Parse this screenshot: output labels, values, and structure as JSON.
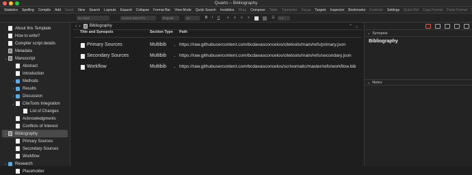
{
  "window": {
    "title": "Quarto – Bibliography"
  },
  "toolbar": {
    "items": [
      {
        "label": "Statistics",
        "enabled": true
      },
      {
        "label": "Spelling",
        "enabled": true
      },
      {
        "label": "Compile",
        "enabled": true
      },
      {
        "label": "Add",
        "enabled": true
      },
      {
        "label": "Insert",
        "enabled": false
      },
      {
        "label": "View",
        "enabled": true
      },
      {
        "label": "Search",
        "enabled": true
      },
      {
        "label": "Layouts",
        "enabled": true
      },
      {
        "label": "Expand",
        "enabled": true
      },
      {
        "label": "Collapse",
        "enabled": true
      },
      {
        "label": "Format Bar",
        "enabled": true
      },
      {
        "label": "View Mode",
        "enabled": true
      },
      {
        "label": "Quick Search",
        "enabled": true
      },
      {
        "label": "Invisibles",
        "enabled": true
      },
      {
        "label": "Wrap",
        "enabled": false
      },
      {
        "label": "Compose",
        "enabled": true
      },
      {
        "label": "Table",
        "enabled": false
      },
      {
        "label": "Typewriter",
        "enabled": false
      },
      {
        "label": "Focus",
        "enabled": false
      },
      {
        "label": "Targets",
        "enabled": true
      },
      {
        "label": "Inspector",
        "enabled": true
      },
      {
        "label": "Bookmarks",
        "enabled": true
      },
      {
        "label": "Footnote",
        "enabled": false
      },
      {
        "label": "Settings",
        "enabled": true
      },
      {
        "label": "Quick Ref",
        "enabled": false
      },
      {
        "label": "Copy Format",
        "enabled": false
      },
      {
        "label": "Paste Format",
        "enabled": false
      },
      {
        "label": "Snapshot",
        "enabled": false
      }
    ]
  },
  "formatbar": {
    "style": "No Style",
    "font": "Source Sans Pro",
    "weight": "Regular",
    "size": "16",
    "bold": "B",
    "italic": "I",
    "underline": "U",
    "line_spacing": "1.0"
  },
  "binder": {
    "items": [
      {
        "label": "About this Template",
        "icon": "document-icon",
        "indent": 0,
        "chevron": ""
      },
      {
        "label": "How to write?",
        "icon": "document-icon",
        "indent": 0,
        "chevron": ""
      },
      {
        "label": "Compiler script details",
        "icon": "document-icon",
        "indent": 0,
        "chevron": ""
      },
      {
        "label": "Metadata",
        "icon": "binder-icon",
        "indent": 0,
        "chevron": ""
      },
      {
        "label": "Manuscript",
        "icon": "binder-icon",
        "indent": 0,
        "chevron": "⌄"
      },
      {
        "label": "Abstract",
        "icon": "document-icon",
        "indent": 1,
        "chevron": ""
      },
      {
        "label": "Introduction",
        "icon": "document-icon",
        "indent": 1,
        "chevron": ""
      },
      {
        "label": "Methods",
        "icon": "folder-icon",
        "indent": 1,
        "chevron": "›"
      },
      {
        "label": "Results",
        "icon": "folder-icon",
        "indent": 1,
        "chevron": "›"
      },
      {
        "label": "Discussion",
        "icon": "folder-icon",
        "indent": 1,
        "chevron": "›"
      },
      {
        "label": "CiteTools Integration",
        "icon": "document-icon",
        "indent": 1,
        "chevron": "⌄"
      },
      {
        "label": "List of Changes",
        "icon": "document-icon",
        "indent": 2,
        "chevron": ""
      },
      {
        "label": "Acknowledgments",
        "icon": "document-icon",
        "indent": 1,
        "chevron": ""
      },
      {
        "label": "Conflicts of Interest",
        "icon": "document-icon",
        "indent": 1,
        "chevron": ""
      },
      {
        "label": "Bibliography",
        "icon": "binder-icon",
        "indent": 0,
        "chevron": "⌄",
        "selected": true
      },
      {
        "label": "Primary Sources",
        "icon": "document-icon",
        "indent": 1,
        "chevron": ""
      },
      {
        "label": "Secondary Sources",
        "icon": "document-icon",
        "indent": 1,
        "chevron": ""
      },
      {
        "label": "Workflow",
        "icon": "document-icon",
        "indent": 1,
        "chevron": ""
      },
      {
        "label": "Research",
        "icon": "research-icon",
        "indent": 0,
        "chevron": "⌄"
      },
      {
        "label": "Placeholder",
        "icon": "document-icon",
        "indent": 1,
        "chevron": ""
      }
    ]
  },
  "editor": {
    "header_title": "Bibliography",
    "columns": {
      "title": "Title and Synopsis",
      "section": "Section Type",
      "path": "Path"
    },
    "rows": [
      {
        "title": "Primary Sources",
        "section": "Multibib",
        "path": "https://raw.githubusercontent.com/bcdavasconcelos/citetools/main/refs/primary.json"
      },
      {
        "title": "Secondary Sources",
        "section": "Multibib",
        "path": "https://raw.githubusercontent.com/bcdavasconcelos/citetools/main/refs/secondary.json"
      },
      {
        "title": "Workflow",
        "section": "Multibib",
        "path": "https://raw.githubusercontent.com/bcdavasconcelos/scrivomatic/master/refs/workflow.bib"
      }
    ]
  },
  "inspector": {
    "synopsis_label": "Synopsis",
    "synopsis_title": "Bibliography",
    "notes_label": "Notes"
  },
  "colors": {
    "background": "#1e1e1e",
    "sidebar": "#262626",
    "selection": "#4a4a4a",
    "folder": "#5aaae0",
    "accent_red": "#e0584f"
  }
}
